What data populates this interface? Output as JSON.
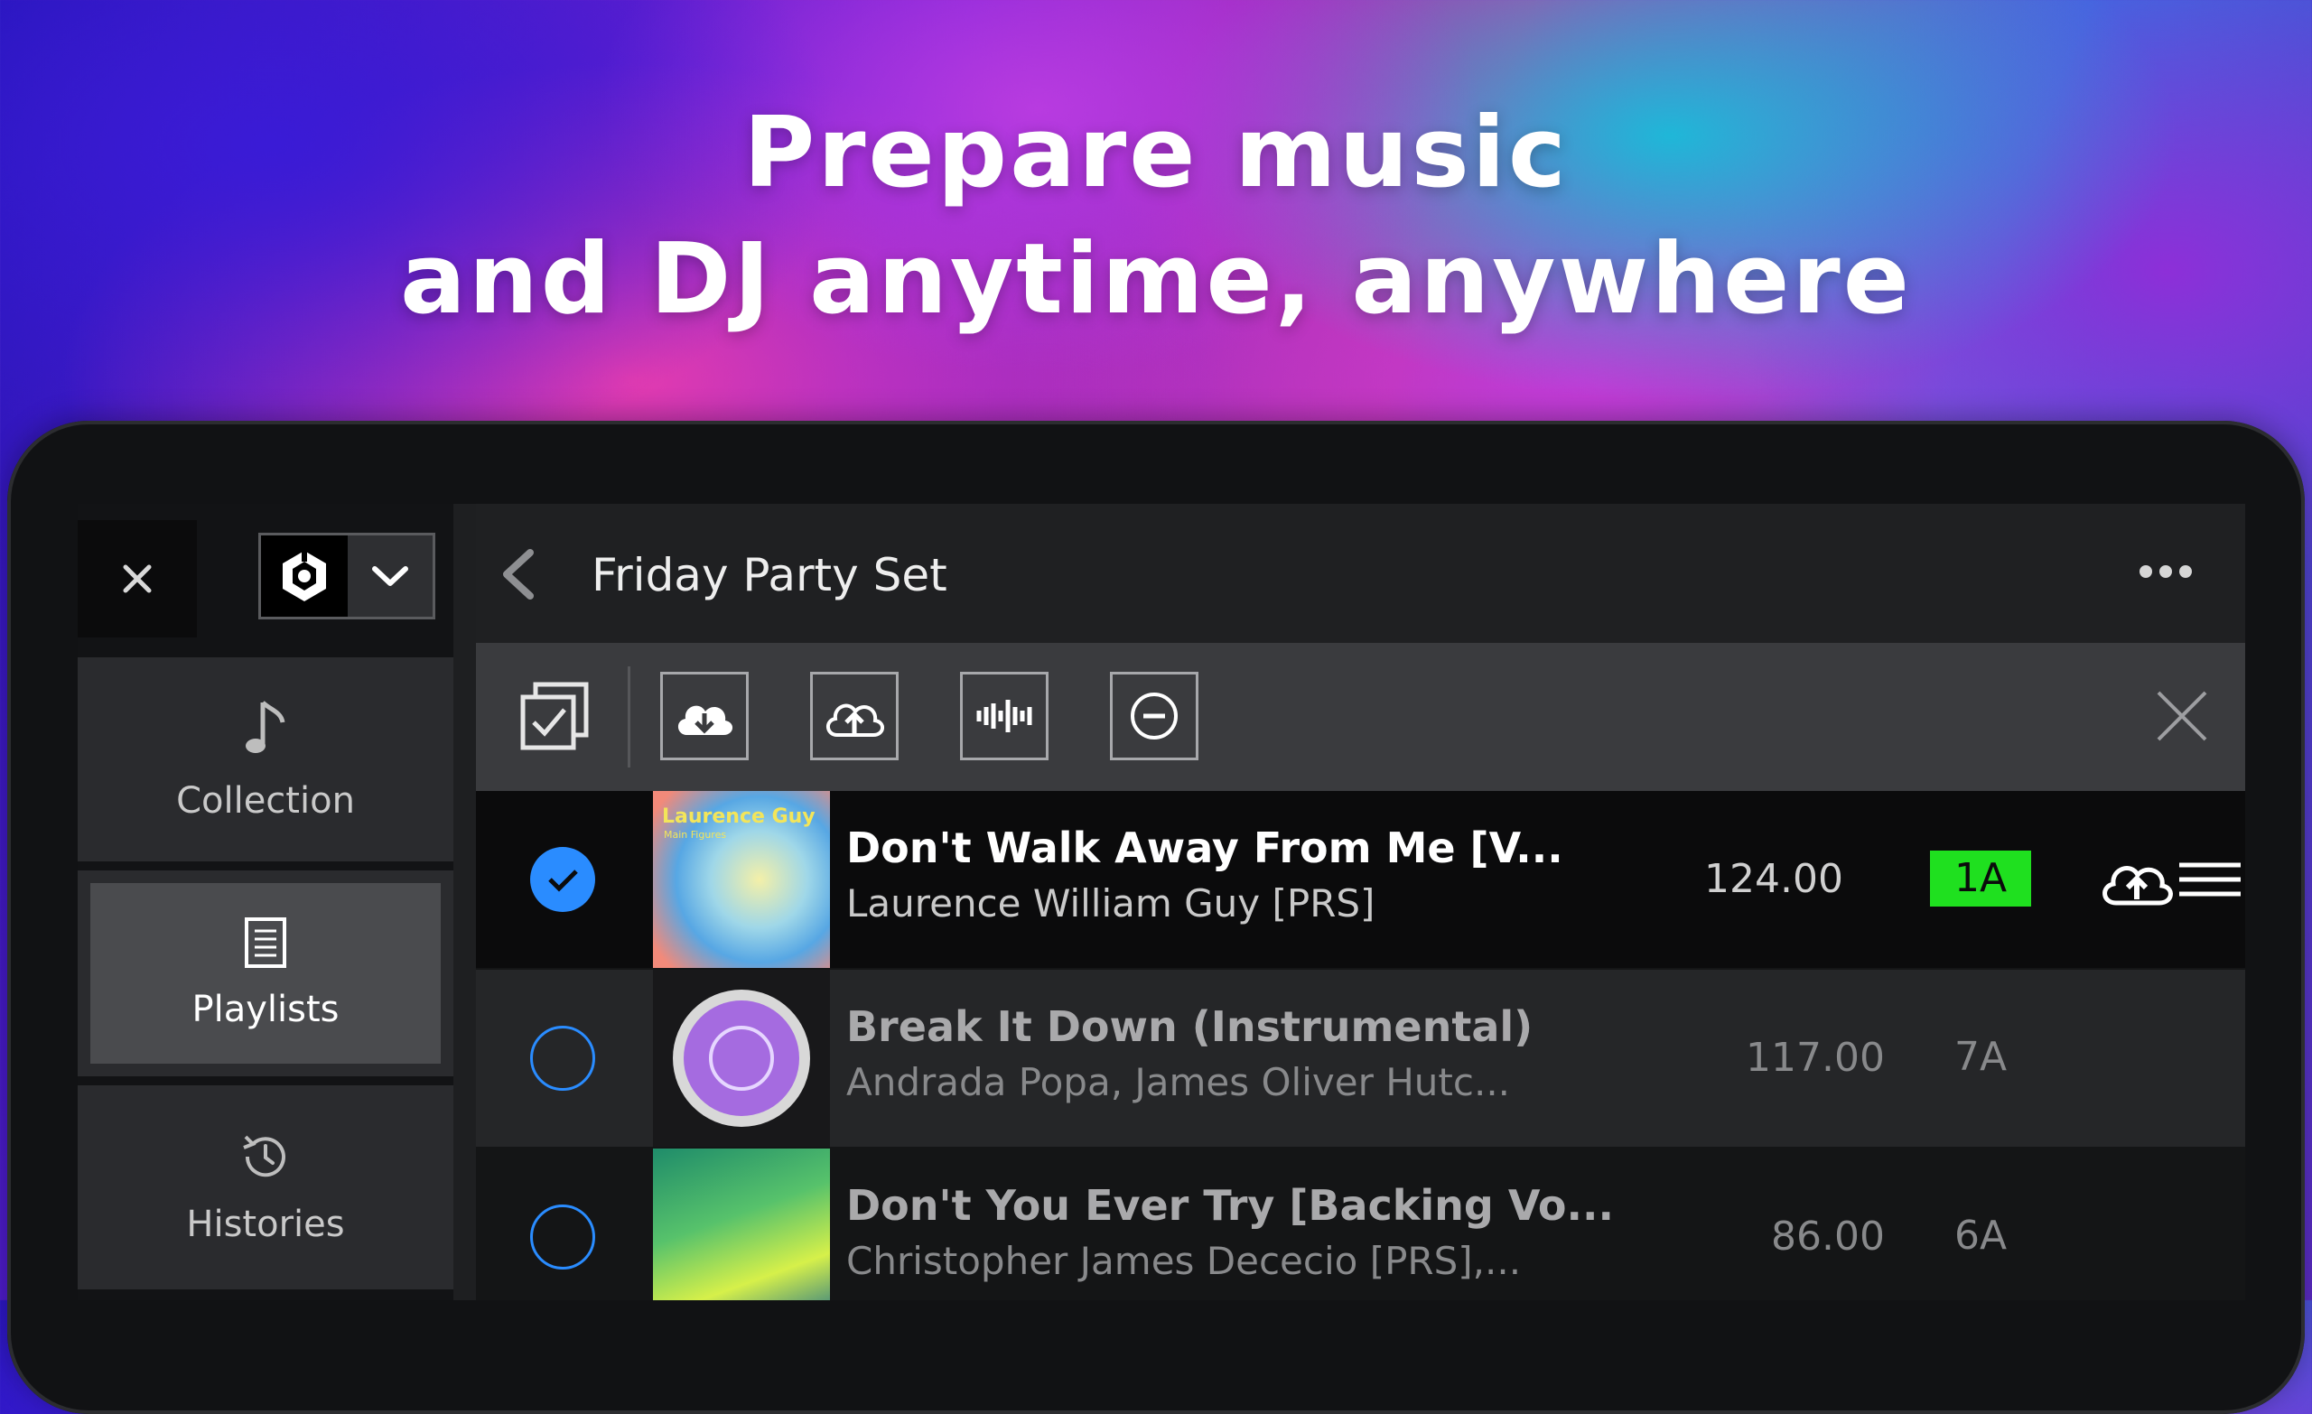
{
  "headline": {
    "line1": "Prepare music",
    "line2": "and DJ anytime, anywhere"
  },
  "sidebar": {
    "close_icon": "close-icon",
    "source_icon": "rekordbox-logo-icon",
    "nav": [
      {
        "label": "Collection",
        "icon": "music-note-icon",
        "active": false
      },
      {
        "label": "Playlists",
        "icon": "playlist-icon",
        "active": true
      },
      {
        "label": "Histories",
        "icon": "history-icon",
        "active": false
      }
    ]
  },
  "header": {
    "title": "Friday Party Set",
    "back_icon": "chevron-left-icon",
    "more_icon": "more-horizontal-icon"
  },
  "toolbar": {
    "buttons": [
      "select-all-icon",
      "cloud-download-icon",
      "cloud-upload-icon",
      "waveform-icon",
      "remove-icon",
      "close-icon"
    ]
  },
  "tracks": [
    {
      "title": "Don't Walk Away From Me [V...",
      "artist": "Laurence William Guy [PRS]",
      "bpm": "124.00",
      "key": "1A",
      "selected": true,
      "art_text": "Laurence Guy",
      "art_subtext": "Main Figures"
    },
    {
      "title": "Break It Down (Instrumental)",
      "artist": "Andrada Popa, James Oliver Hutc...",
      "bpm": "117.00",
      "key": "7A",
      "selected": false,
      "art_text": "",
      "art_subtext": ""
    },
    {
      "title": "Don't You Ever Try [Backing Vo...",
      "artist": "Christopher James Dececio [PRS],...",
      "bpm": "86.00",
      "key": "6A",
      "selected": false,
      "art_text": "",
      "art_subtext": ""
    }
  ],
  "colors": {
    "accent_blue": "#2a8cff",
    "key_green": "#1fe01f",
    "selected_row": "#0b0b0c",
    "row_dim": "#252628"
  }
}
